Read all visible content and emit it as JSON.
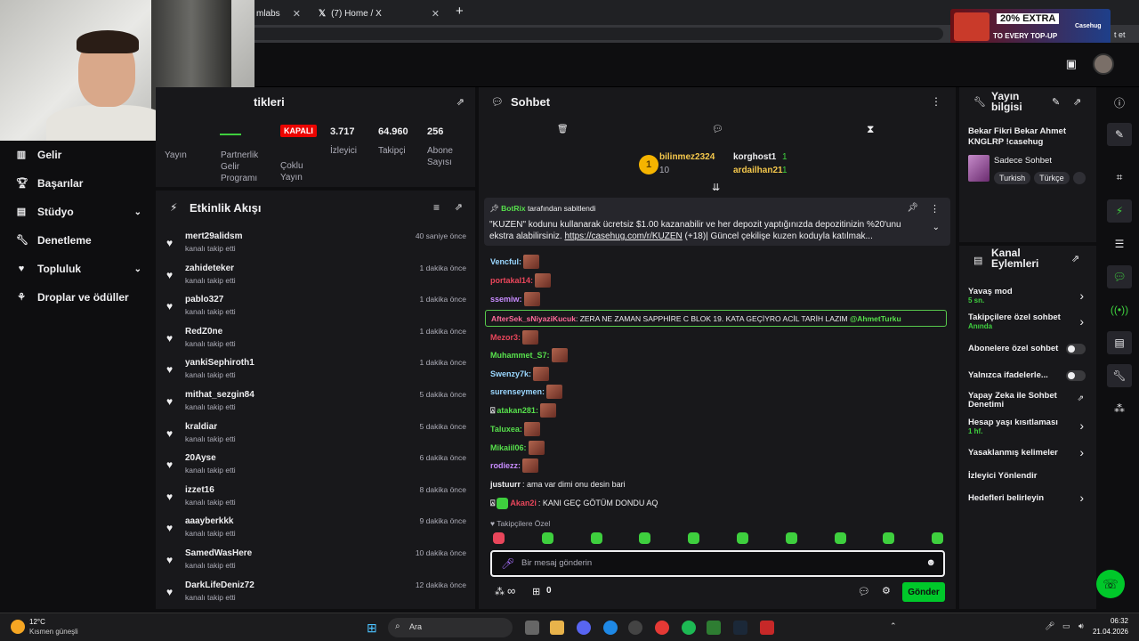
{
  "browser": {
    "tabs": [
      {
        "title": "mlabs"
      },
      {
        "title": "(7) Home / X"
      }
    ],
    "new_tab": "+",
    "ad": {
      "line1": "20% EXTRA",
      "line2": "TO EVERY TOP-UP",
      "brand": "Casehug"
    },
    "ad_tail": "t et"
  },
  "sidebar": {
    "items": [
      {
        "label": "Gelir"
      },
      {
        "label": "Başarılar"
      },
      {
        "label": "Stüdyo"
      },
      {
        "label": "Denetleme"
      },
      {
        "label": "Topluluk"
      },
      {
        "label": "Droplar ve ödüller"
      }
    ]
  },
  "stats": {
    "title": "tikleri",
    "columns": [
      {
        "label": "Yayın"
      },
      {
        "label": "Partnerlik Gelir Programı"
      },
      {
        "label": "Çoklu Yayın"
      },
      {
        "value": "3.717",
        "label": "İzleyici"
      },
      {
        "value": "64.960",
        "label": "Takipçi"
      },
      {
        "value": "256",
        "label": "Abone Sayısı"
      }
    ],
    "status": "KAPALI"
  },
  "feed": {
    "title": "Etkinlik Akışı",
    "items": [
      {
        "name": "mert29alidsm",
        "action": "kanalı takip etti",
        "time": "40 saniye önce"
      },
      {
        "name": "zahideteker",
        "action": "kanalı takip etti",
        "time": "1 dakika önce"
      },
      {
        "name": "pablo327",
        "action": "kanalı takip etti",
        "time": "1 dakika önce"
      },
      {
        "name": "RedZ0ne",
        "action": "kanalı takip etti",
        "time": "1 dakika önce"
      },
      {
        "name": "yankiSephiroth1",
        "action": "kanalı takip etti",
        "time": "1 dakika önce"
      },
      {
        "name": "mithat_sezgin84",
        "action": "kanalı takip etti",
        "time": "5 dakika önce"
      },
      {
        "name": "kraldiar",
        "action": "kanalı takip etti",
        "time": "5 dakika önce"
      },
      {
        "name": "20Ayse",
        "action": "kanalı takip etti",
        "time": "6 dakika önce"
      },
      {
        "name": "izzet16",
        "action": "kanalı takip etti",
        "time": "8 dakika önce"
      },
      {
        "name": "aaayberkkk",
        "action": "kanalı takip etti",
        "time": "9 dakika önce"
      },
      {
        "name": "SamedWasHere",
        "action": "kanalı takip etti",
        "time": "10 dakika önce"
      },
      {
        "name": "DarkLifeDeniz72",
        "action": "kanalı takip etti",
        "time": "12 dakika önce"
      }
    ]
  },
  "chat": {
    "title": "Sohbet",
    "leaderboard": [
      {
        "rank": "1",
        "name": "bilinmez2324",
        "count": "10"
      },
      {
        "name": "korghost1",
        "count": "1"
      },
      {
        "name": "ardailhan21",
        "count": "1"
      }
    ],
    "pinned": {
      "author": "BotRix",
      "suffix": "tarafından sabitlendi",
      "text": "\"KUZEN\" kodunu kullanarak ücretsiz $1.00 kazanabilir ve her depozit yaptığınızda depozitinizin %20'unu ekstra alabilirsiniz.",
      "link": "https://casehug.com/r/KUZEN",
      "text2": "(+18)| Güncel çekilişe kuzen koduyla katılmak..."
    },
    "messages": [
      {
        "user": "Vencful:",
        "color": "#9ad7ff"
      },
      {
        "user": "portakal14:",
        "color": "#e9465b"
      },
      {
        "user": "ssemiw:",
        "color": "#c88cff"
      },
      {
        "user": "Mezor3:",
        "color": "#e9465b"
      },
      {
        "user": "Muhammet_S7:",
        "color": "#57e04c"
      },
      {
        "user": "Swenzy7k:",
        "color": "#9ad7ff"
      },
      {
        "user": "surenseymen:",
        "color": "#9ad7ff"
      },
      {
        "user": "atakan281:",
        "color": "#57e04c"
      },
      {
        "user": "Taluxea:",
        "color": "#57e04c"
      },
      {
        "user": "Mikaiil06:",
        "color": "#57e04c"
      },
      {
        "user": "rodiezz:",
        "color": "#c88cff"
      }
    ],
    "highlight": {
      "user": "AfterSek_sNiyaziKucuk",
      "text": ": ZERA NE ZAMAN SAPPHİRE C BLOK 19. KATA GEÇİYRO ACİL TARİH LAZIM",
      "mention": "@AhmetTurku"
    },
    "msg_justuurr": {
      "user": "justuurr",
      "text": ": ama var dimi onu desin bari"
    },
    "msg_akan": {
      "user": "Akan2i",
      "text": ": KANI GEÇ GÖTÜM DONDU AQ"
    },
    "followers_only": "Takipçilere Özel",
    "placeholder": "Bir mesaj gönderin",
    "send": "Gönder",
    "infinity": "∞",
    "points": "0"
  },
  "info": {
    "title": "Yayın bilgisi",
    "stream_title": "Bekar Fikri Bekar Ahmet KNGLRP !casehug",
    "category": "Sadece Sohbet",
    "tags": [
      "Turkish",
      "Türkçe"
    ]
  },
  "actions": {
    "title": "Kanal Eylemleri",
    "items": [
      {
        "label": "Yavaş mod",
        "sub": "5 sn."
      },
      {
        "label": "Takipçilere özel sohbet",
        "sub": "Anında"
      },
      {
        "label": "Abonelere özel sohbet"
      },
      {
        "label": "Yalnızca ifadelerle..."
      },
      {
        "label": "Yapay Zeka ile Sohbet Denetimi"
      },
      {
        "label": "Hesap yaşı kısıtlaması",
        "sub": "1 hf."
      },
      {
        "label": "Yasaklanmış kelimeler"
      },
      {
        "label": "İzleyici Yönlendir"
      },
      {
        "label": "Hedefleri belirleyin"
      }
    ]
  },
  "taskbar": {
    "temp": "12°C",
    "weather": "Kısmen güneşli",
    "search": "Ara",
    "time": "06:32",
    "date": "21.04.2026"
  }
}
